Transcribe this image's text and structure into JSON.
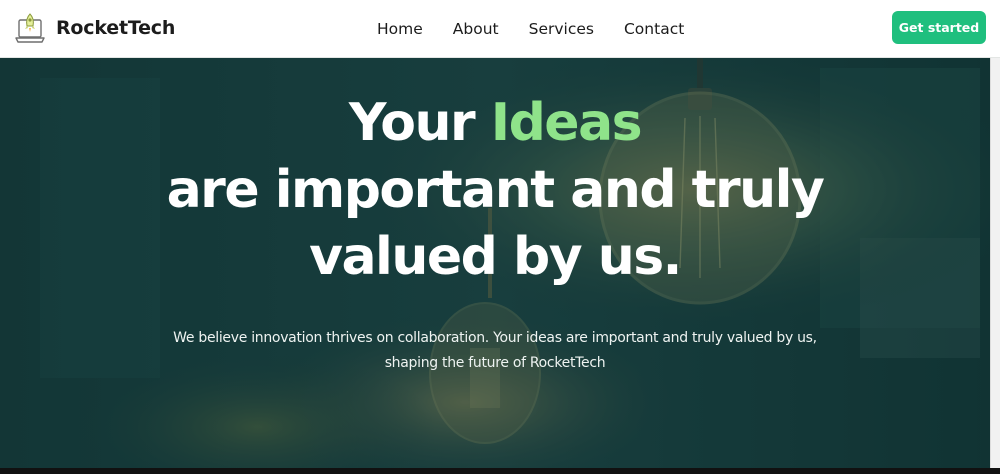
{
  "header": {
    "brand_name": "RocketTech",
    "logo_icon": "laptop-rocket-icon",
    "nav": [
      {
        "label": "Home"
      },
      {
        "label": "About"
      },
      {
        "label": "Services"
      },
      {
        "label": "Contact"
      }
    ],
    "cta_label": "Get started"
  },
  "hero": {
    "title_part1": "Your ",
    "title_accent": "Ideas",
    "title_line2": "are important and truly",
    "title_line3": "valued by us.",
    "subtitle_line1": "We believe innovation thrives on collaboration. Your ideas are important and truly valued by us,",
    "subtitle_line2": "shaping the future of RocketTech",
    "background_image": "light-bulb-photo"
  },
  "colors": {
    "accent_green": "#8fe38a",
    "button_green": "#1fbf7e",
    "hero_tint": "#1a3b3a"
  }
}
